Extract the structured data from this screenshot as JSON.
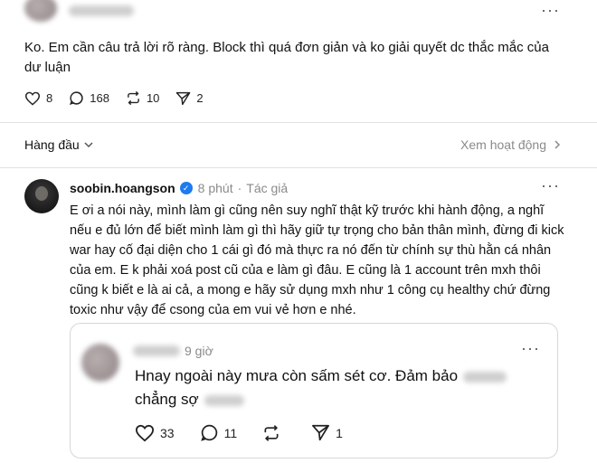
{
  "post": {
    "text": "Ko. Em cần câu trả lời rõ ràng. Block thì quá đơn giản và ko giải quyết dc thắc mắc của dư luận",
    "likes": "8",
    "comments": "168",
    "reposts": "10",
    "shares": "2"
  },
  "sort": {
    "label": "Hàng đầu",
    "view_activity": "Xem hoạt động"
  },
  "reply": {
    "username": "soobin.hoangson",
    "time": "8 phút",
    "separator": "·",
    "role": "Tác giả",
    "text": "E ơi a nói này, mình làm gì cũng nên suy nghĩ thật kỹ trước khi hành động, a nghĩ nếu e đủ lớn để biết mình làm gì thì hãy giữ tự trọng cho bản thân mình, đừng đi kick war hay cố đại diện cho 1 cái gì đó mà thực ra nó đến từ chính sự thù hằn cá nhân của em. E k phải xoá post cũ của e làm gì đâu. E cũng là 1 account trên mxh thôi cũng k biết e là ai cả, a mong e hãy sử dụng mxh như 1 công cụ healthy chứ đừng toxic như vậy để csong của em vui vẻ hơn e nhé."
  },
  "quote": {
    "time": "9 giờ",
    "text_part1": "Hnay ngoài này mưa còn sấm sét cơ. Đảm bảo",
    "text_part2": "chẳng sợ",
    "likes": "33",
    "comments": "11",
    "shares": "1"
  },
  "icons": {
    "heart": "heart-icon",
    "comment": "comment-icon",
    "repost": "repost-icon",
    "share": "share-icon",
    "verified": "verified-badge-icon",
    "more": "more-icon",
    "chevron_down": "chevron-down-icon",
    "chevron_right": "chevron-right-icon"
  },
  "colors": {
    "verified": "#1d7bf0",
    "muted": "#8a8a8a"
  }
}
